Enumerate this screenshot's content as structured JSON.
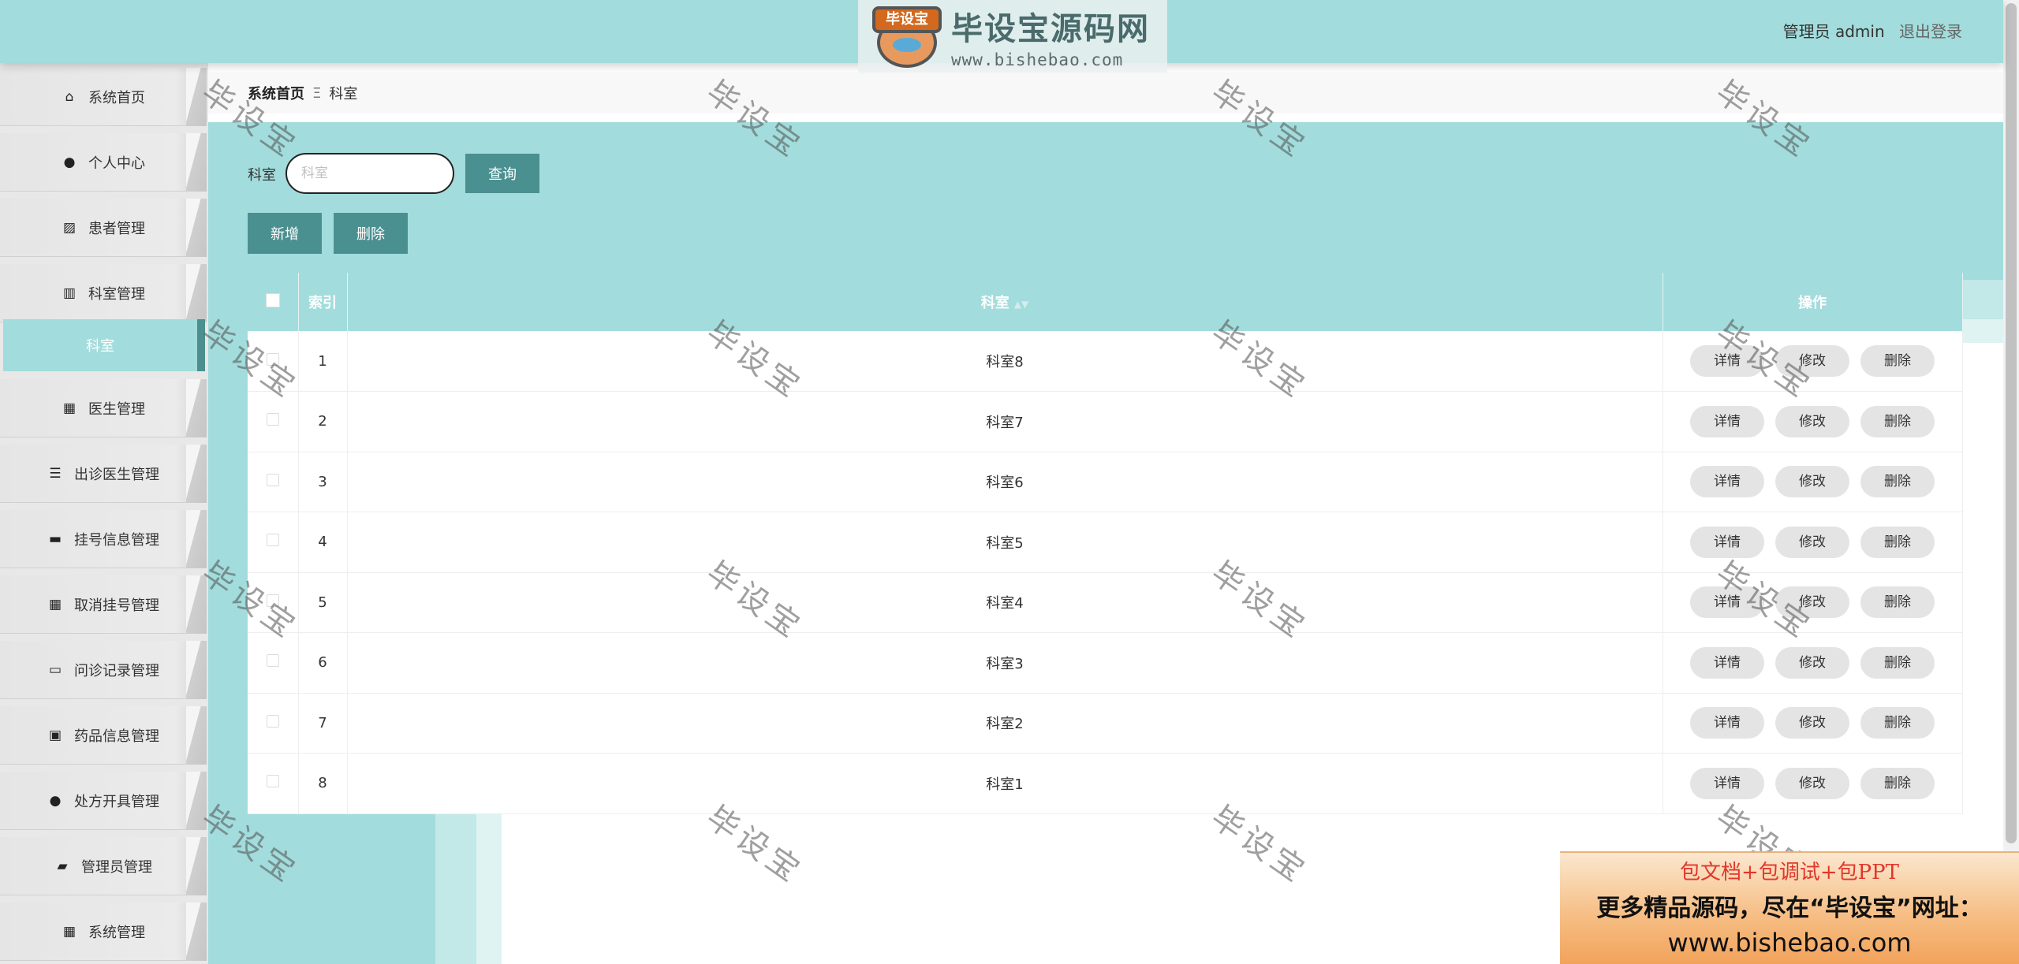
{
  "header": {
    "logo_badge": "毕设宝",
    "logo_title": "毕设宝源码网",
    "logo_url": "www.bishebao.com",
    "user": "管理员 admin",
    "logout": "退出登录"
  },
  "sidebar": {
    "items": [
      {
        "label": "系统首页",
        "icon": "home-icon",
        "glyph": "⌂"
      },
      {
        "label": "个人中心",
        "icon": "user-icon",
        "glyph": "●"
      },
      {
        "label": "患者管理",
        "icon": "chart-icon",
        "glyph": "▨"
      },
      {
        "label": "科室管理",
        "icon": "books-icon",
        "glyph": "▥"
      },
      {
        "label": "医生管理",
        "icon": "grid-icon",
        "glyph": "▦"
      },
      {
        "label": "出诊医生管理",
        "icon": "list-icon",
        "glyph": "☰"
      },
      {
        "label": "挂号信息管理",
        "icon": "inbox-icon",
        "glyph": "▬"
      },
      {
        "label": "取消挂号管理",
        "icon": "grid-icon",
        "glyph": "▦"
      },
      {
        "label": "问诊记录管理",
        "icon": "monitor-icon",
        "glyph": "▭"
      },
      {
        "label": "药品信息管理",
        "icon": "clipboard-icon",
        "glyph": "▣"
      },
      {
        "label": "处方开具管理",
        "icon": "pin-icon",
        "glyph": "●"
      },
      {
        "label": "管理员管理",
        "icon": "wallet-icon",
        "glyph": "▰"
      },
      {
        "label": "系统管理",
        "icon": "grid-icon",
        "glyph": "▦"
      }
    ],
    "submenu": "科室"
  },
  "breadcrumb": {
    "home": "系统首页",
    "sep": "Ξ",
    "current": "科室"
  },
  "search": {
    "label": "科室",
    "placeholder": "科室",
    "value": "",
    "query_button": "查询"
  },
  "actions": {
    "add": "新增",
    "delete": "删除"
  },
  "table": {
    "headers": {
      "index": "索引",
      "name": "科室",
      "ops": "操作"
    },
    "rows": [
      {
        "index": "1",
        "name": "科室8"
      },
      {
        "index": "2",
        "name": "科室7"
      },
      {
        "index": "3",
        "name": "科室6"
      },
      {
        "index": "4",
        "name": "科室5"
      },
      {
        "index": "5",
        "name": "科室4"
      },
      {
        "index": "6",
        "name": "科室3"
      },
      {
        "index": "7",
        "name": "科室2"
      },
      {
        "index": "8",
        "name": "科室1"
      }
    ],
    "row_ops": {
      "detail": "详情",
      "edit": "修改",
      "delete": "删除"
    }
  },
  "watermark": "毕设宝",
  "ad": {
    "line1": "包文档+包调试+包PPT",
    "line2": "更多精品源码，尽在“毕设宝”网址：",
    "line3": "www.bishebao.com"
  },
  "colors": {
    "theme": "#a3dcdc",
    "button": "#4b9090",
    "ad_red": "#e2362a"
  }
}
